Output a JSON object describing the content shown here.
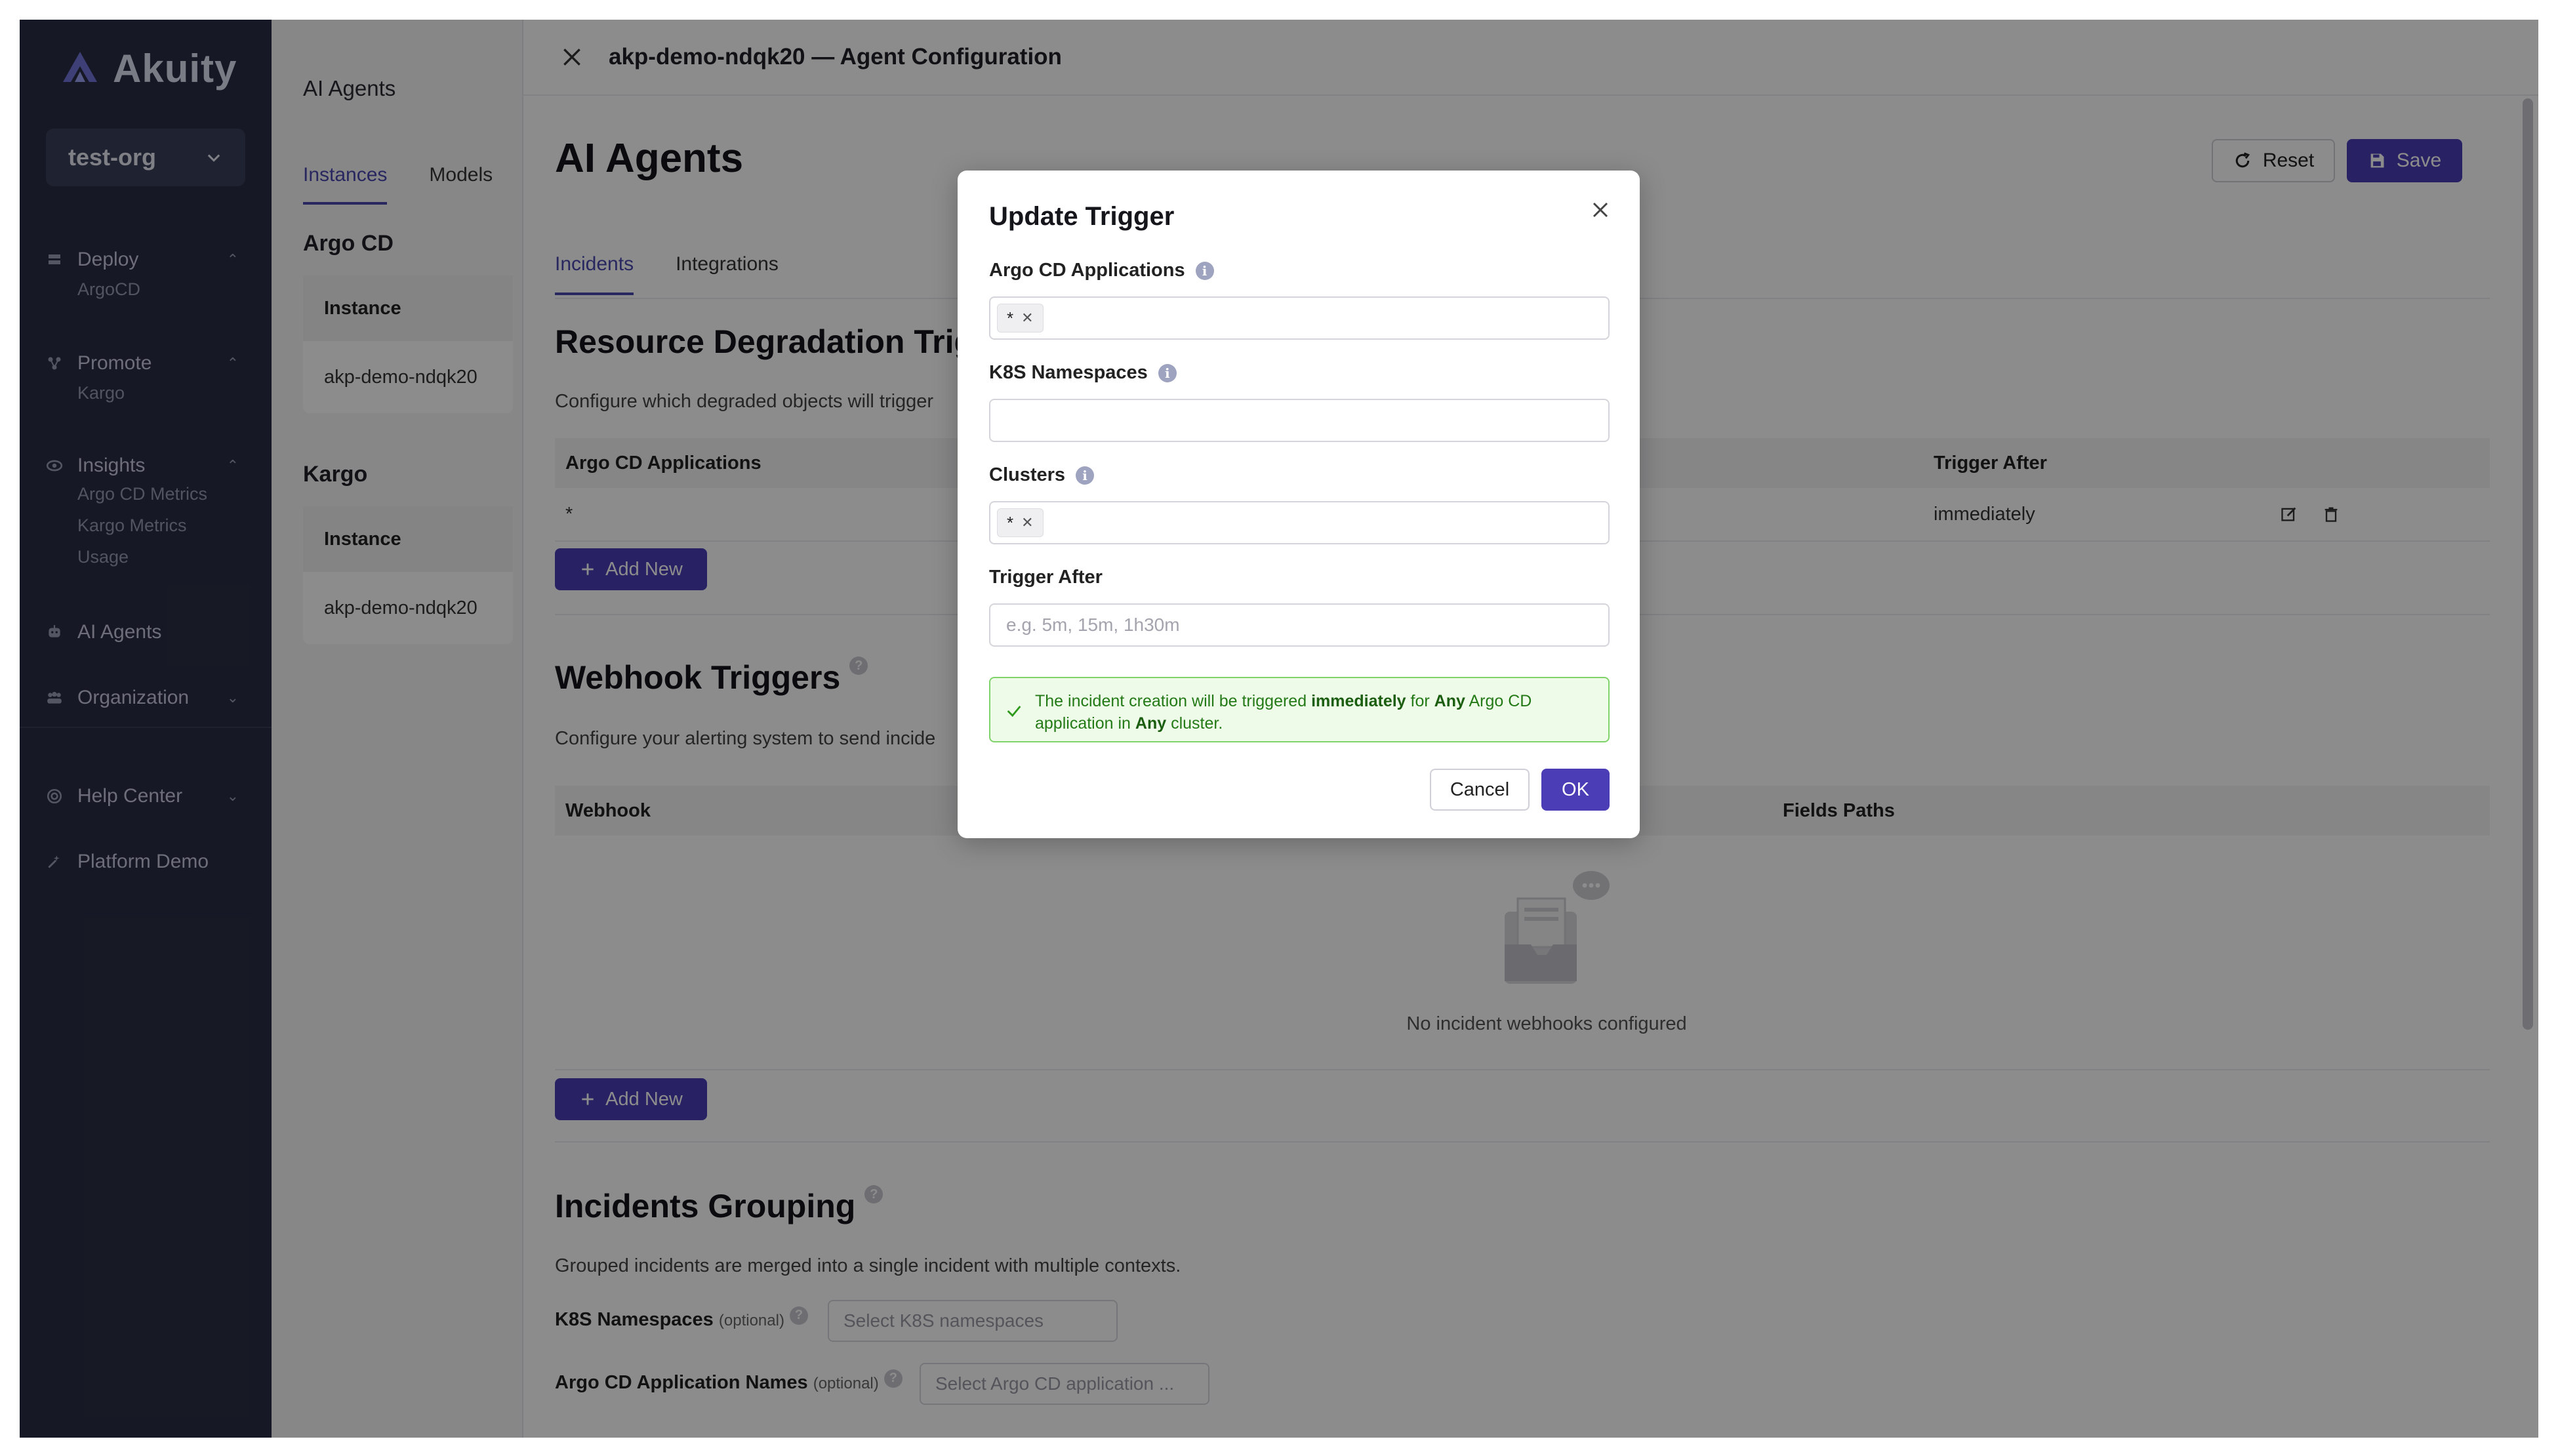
{
  "sidebar": {
    "logo_text": "Akuity",
    "org": "test-org",
    "items": [
      {
        "label": "Deploy",
        "icon": "deploy-icon"
      },
      {
        "label": "ArgoCD"
      },
      {
        "label": "Promote",
        "icon": "promote-icon"
      },
      {
        "label": "Kargo"
      },
      {
        "label": "Insights",
        "icon": "insights-icon"
      },
      {
        "label": "Argo CD Metrics"
      },
      {
        "label": "Kargo Metrics"
      },
      {
        "label": "Usage"
      },
      {
        "label": "AI Agents",
        "icon": "ai-agents-icon"
      },
      {
        "label": "Organization",
        "icon": "organization-icon"
      },
      {
        "label": "Help Center",
        "icon": "help-icon"
      },
      {
        "label": "Platform Demo",
        "icon": "platform-demo-icon"
      }
    ]
  },
  "middle": {
    "title": "AI Agents",
    "tabs": [
      "Instances",
      "Models"
    ],
    "argo_section": "Argo CD",
    "kargo_section": "Kargo",
    "col_header": "Instance",
    "argo_instance": "akp-demo-ndqk20",
    "kargo_instance": "akp-demo-ndqk20"
  },
  "main": {
    "header_title": "akp-demo-ndqk20 — Agent Configuration",
    "page_title": "AI Agents",
    "reset_label": "Reset",
    "save_label": "Save",
    "tabs": [
      "Incidents",
      "Integrations"
    ],
    "degradation": {
      "title": "Resource Degradation Trig",
      "desc": "Configure which degraded objects will trigger",
      "col_apps": "Argo CD Applications",
      "col_trigger": "Trigger After",
      "row_apps": "*",
      "row_trigger": "immediately",
      "add_label": "Add New"
    },
    "webhook": {
      "title": "Webhook Triggers",
      "desc": "Configure your alerting system to send incide",
      "col_webhook": "Webhook",
      "col_fields": "Fields Paths",
      "empty": "No incident webhooks configured",
      "add_label": "Add New"
    },
    "grouping": {
      "title": "Incidents Grouping",
      "desc": "Grouped incidents are merged into a single incident with multiple contexts.",
      "ns_label": "K8S Namespaces",
      "ns_optional": "(optional)",
      "ns_placeholder": "Select K8S namespaces",
      "app_label": "Argo CD Application Names",
      "app_optional": "(optional)",
      "app_placeholder": "Select Argo CD application ..."
    }
  },
  "modal": {
    "title": "Update Trigger",
    "apps_label": "Argo CD Applications",
    "apps_tag": "*",
    "ns_label": "K8S Namespaces",
    "clusters_label": "Clusters",
    "clusters_tag": "*",
    "trigger_label": "Trigger After",
    "trigger_placeholder": "e.g. 5m, 15m, 1h30m",
    "alert": {
      "p1": "The incident creation will be triggered ",
      "b1": "immediately",
      "p2": " for ",
      "b2": "Any",
      "p3": " Argo CD application in ",
      "b3": "Any",
      "p4": " cluster."
    },
    "cancel_label": "Cancel",
    "ok_label": "OK"
  },
  "colors": {
    "primary": "#4a3db5",
    "success_bg": "#eefbe9",
    "success_border": "#7fd36a",
    "sidebar_bg": "#2a2d44"
  }
}
